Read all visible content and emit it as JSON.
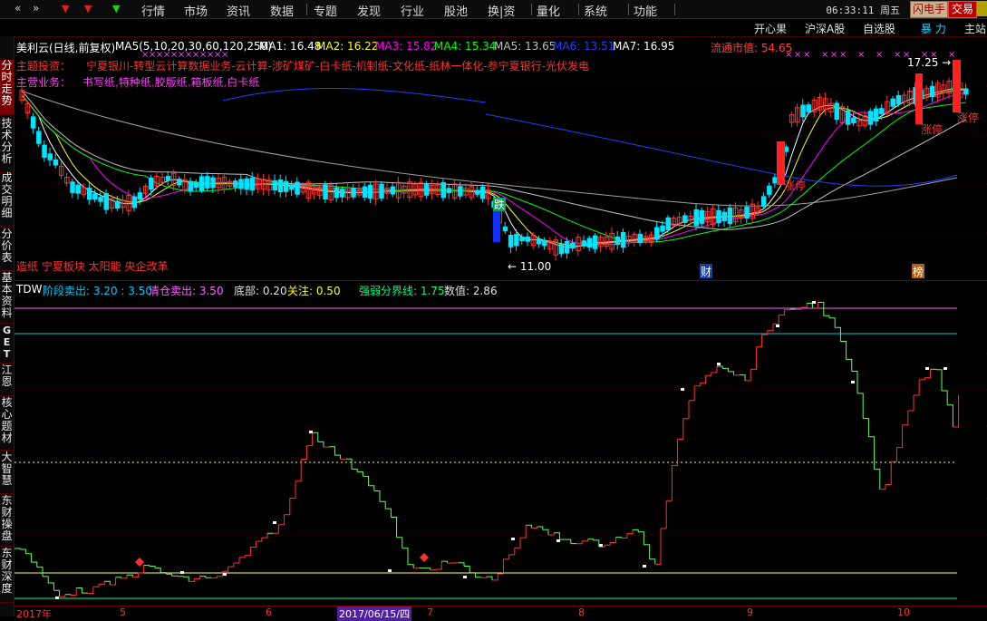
{
  "menu": {
    "items": [
      "行情",
      "市场",
      "资讯",
      "数据",
      "专题",
      "发现",
      "行业",
      "股池",
      "换|资",
      "量化",
      "系统",
      "功能"
    ],
    "clock": "06:33:11",
    "weekday": "周五",
    "flash_btn": "闪电手",
    "trade_btn": "交易"
  },
  "subbar": {
    "items": [
      "开心果",
      "沪深A股",
      "自选股",
      "暴 力",
      "主站"
    ]
  },
  "sidebar": {
    "tabs": [
      "分时走势",
      "技术分析",
      "成交明细",
      "分价表",
      "基本资料",
      "GET",
      "江恩",
      "核心题材",
      "大智慧",
      "东财操盘",
      "东财深度"
    ]
  },
  "stock": {
    "name": "美利云(日线,前复权)",
    "ma_params": "MA5(5,10,20,30,60,120,250)",
    "ma": [
      {
        "label": "MA1: 16.48",
        "color": "#ffffff"
      },
      {
        "label": "MA2: 16.22",
        "color": "#ffff00"
      },
      {
        "label": "MA3: 15.82",
        "color": "#ff00ff"
      },
      {
        "label": "MA4: 15.34",
        "color": "#00ff00"
      },
      {
        "label": "MA5: 13.65",
        "color": "#c0c0c0"
      },
      {
        "label": "MA6: 13.51",
        "color": "#2040ff"
      },
      {
        "label": "MA7: 16.95",
        "color": "#ffffff"
      }
    ],
    "market_cap": "流通市值: 54.65",
    "theme_label": "主题投资：",
    "theme_text": "宁夏银川-转型云计算数据业务-云计算-涉矿煤矿-白卡纸-机制纸-文化纸-纸林一体化-参宁夏银行-光伏发电",
    "business_label": "主营业务：",
    "business_text": "书写纸,特种纸,胶版纸,箱板纸,白卡纸",
    "concepts": "造纸 宁夏板块 太阳能 央企改革",
    "high_label": "17.25",
    "low_label": "11.00",
    "limit_up_1": "涨停",
    "limit_up_2": "涨停",
    "limit_up_3": "涨停",
    "marker_die": "跌",
    "marker_cai": "财",
    "marker_bang": "榜"
  },
  "indicator": {
    "name": "TDW",
    "items": [
      {
        "label": "阶段卖出: 3.20 : 3.50",
        "color": "#00c8ff"
      },
      {
        "label": "清仓卖出: 3.50",
        "color": "#ff60ff"
      },
      {
        "label": "底部: 0.20",
        "color": "#e0e0e0"
      },
      {
        "label": "关注: 0.50",
        "color": "#ffff00"
      },
      {
        "label": "强弱分界线: 1.75",
        "color": "#00ff80"
      },
      {
        "label": "数值: 2.86",
        "color": "#e0e0e0"
      }
    ]
  },
  "xaxis": {
    "labels": [
      "2017年",
      "5",
      "6",
      "2017/06/15/四",
      "7",
      "8",
      "9",
      "10"
    ]
  },
  "colors": {
    "up": "#ff3030",
    "down": "#00e5ff",
    "accent": "#7a0000"
  }
}
